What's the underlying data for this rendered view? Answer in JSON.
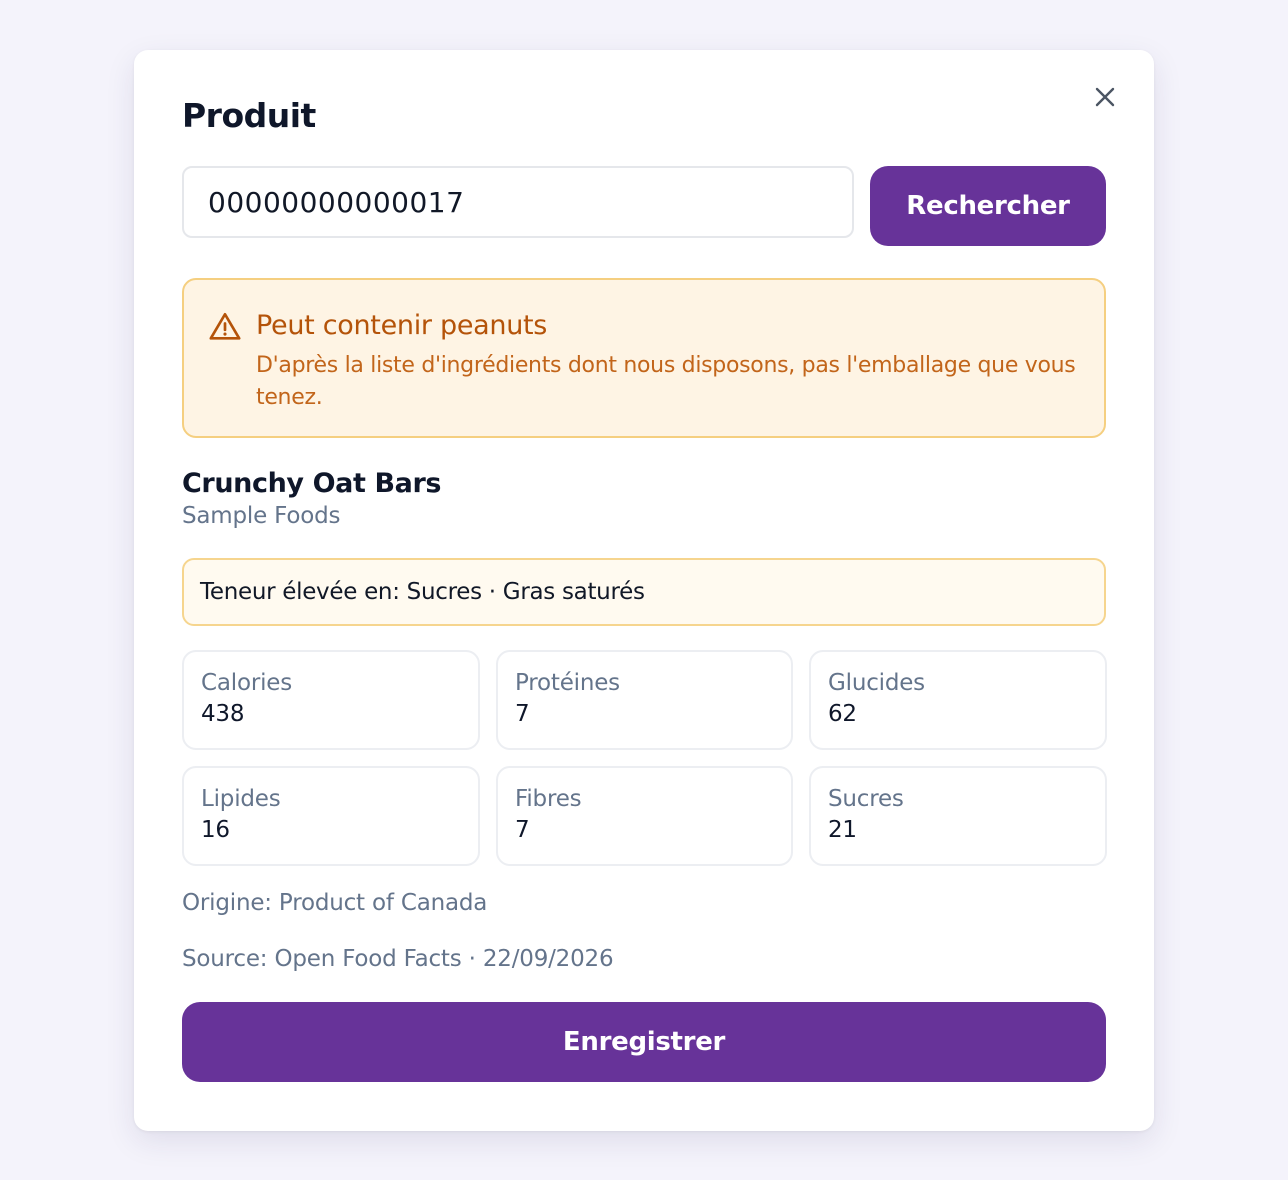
{
  "dialog": {
    "title": "Produit",
    "close_icon": "close-icon"
  },
  "search": {
    "value": "00000000000017",
    "button_label": "Rechercher"
  },
  "warning": {
    "icon": "warning-triangle-icon",
    "title": "Peut contenir peanuts",
    "text": "D'après la liste d'ingrédients dont nous disposons, pas l'emballage que vous tenez."
  },
  "product": {
    "name": "Crunchy Oat Bars",
    "brand": "Sample Foods"
  },
  "high_content": {
    "text": "Teneur élevée en: Sucres · Gras saturés"
  },
  "nutrients": [
    {
      "label": "Calories",
      "value": "438"
    },
    {
      "label": "Protéines",
      "value": "7"
    },
    {
      "label": "Glucides",
      "value": "62"
    },
    {
      "label": "Lipides",
      "value": "16"
    },
    {
      "label": "Fibres",
      "value": "7"
    },
    {
      "label": "Sucres",
      "value": "21"
    }
  ],
  "origin": "Origine: Product of Canada",
  "source": "Source: Open Food Facts · 22/09/2026",
  "save_label": "Enregistrer",
  "colors": {
    "accent": "#673399",
    "warning_bg": "#fef4e4",
    "warning_border": "#f5cf80",
    "warning_text": "#b45309"
  }
}
